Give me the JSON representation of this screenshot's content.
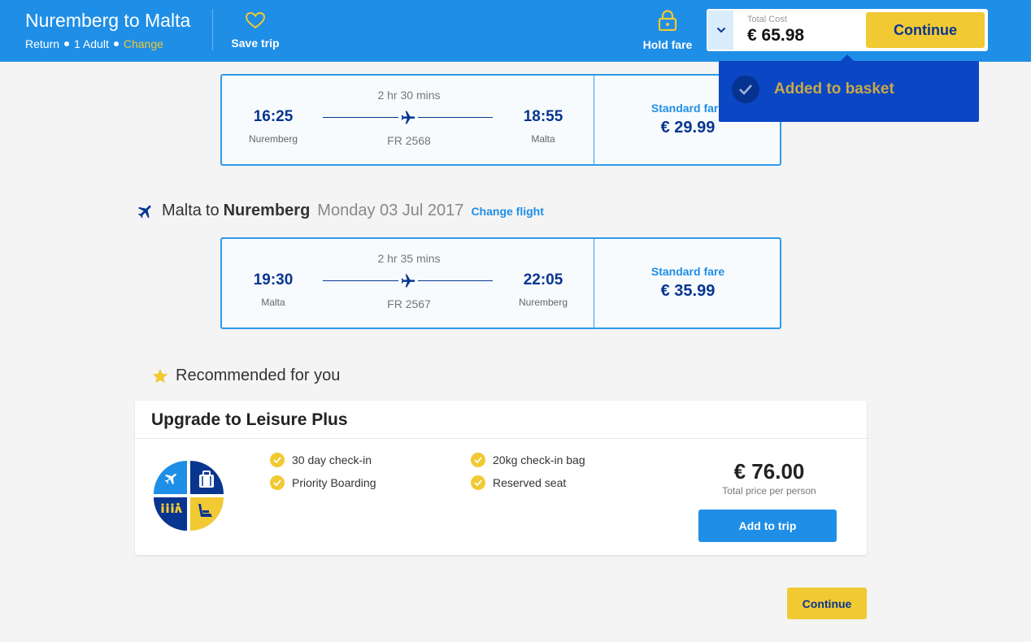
{
  "header": {
    "title": "Nuremberg to Malta",
    "trip_type": "Return",
    "passengers": "1 Adult",
    "change_label": "Change",
    "save_trip_label": "Save trip",
    "hold_fare_label": "Hold fare",
    "total_cost_label": "Total Cost",
    "total_cost_value": "€ 65.98",
    "continue_label": "Continue"
  },
  "toast": {
    "message": "Added to basket"
  },
  "outbound": {
    "duration": "2 hr 30 mins",
    "dep_time": "16:25",
    "dep_city": "Nuremberg",
    "arr_time": "18:55",
    "arr_city": "Malta",
    "flight_no": "FR 2568",
    "fare_label": "Standard fare",
    "fare_price": "€ 29.99"
  },
  "return_section": {
    "origin": "Malta",
    "to": "to",
    "destination": "Nuremberg",
    "date": "Monday 03 Jul 2017",
    "change_flight_label": "Change flight"
  },
  "inbound": {
    "duration": "2 hr 35 mins",
    "dep_time": "19:30",
    "dep_city": "Malta",
    "arr_time": "22:05",
    "arr_city": "Nuremberg",
    "flight_no": "FR 2567",
    "fare_label": "Standard fare",
    "fare_price": "€ 35.99"
  },
  "recommended": {
    "heading": "Recommended for you",
    "card_title": "Upgrade to Leisure Plus",
    "benefits": [
      "30 day check-in",
      "20kg check-in bag",
      "Priority Boarding",
      "Reserved seat"
    ],
    "price": "€ 76.00",
    "price_note": "Total price per person",
    "add_button_label": "Add to trip"
  },
  "footer": {
    "continue_label": "Continue"
  },
  "colors": {
    "brand_blue": "#1f8ee6",
    "dark_blue": "#073590",
    "accent_yellow": "#f1c933",
    "toast_blue": "#0b46c4"
  },
  "icons": {
    "save_trip": "heart-icon",
    "hold_fare": "lock-icon",
    "cost_toggle": "chevron-down-icon",
    "toast": "check-icon",
    "flight": "plane-icon",
    "recommended": "star-icon",
    "benefit": "check-icon"
  }
}
